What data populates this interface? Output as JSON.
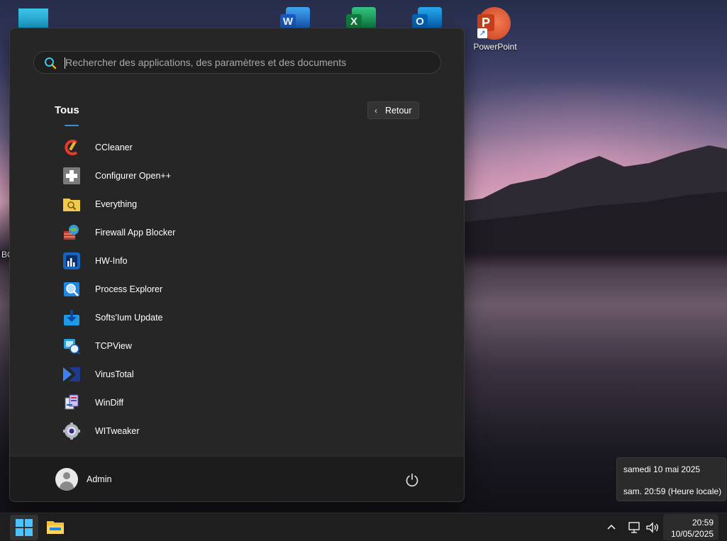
{
  "desktop": {
    "partial_label": "BC",
    "powerpoint_label": "PowerPoint"
  },
  "start_menu": {
    "search": {
      "placeholder": "Rechercher des applications, des paramètres et des documents",
      "value": ""
    },
    "section_title": "Tous",
    "back_label": "Retour",
    "apps": [
      {
        "label": "CCleaner",
        "icon": "ccleaner-icon"
      },
      {
        "label": "Configurer Open++",
        "icon": "open-plus-plus-icon"
      },
      {
        "label": "Everything",
        "icon": "everything-icon"
      },
      {
        "label": "Firewall App Blocker",
        "icon": "firewall-app-blocker-icon"
      },
      {
        "label": "HW-Info",
        "icon": "hwinfo-icon"
      },
      {
        "label": "Process Explorer",
        "icon": "process-explorer-icon"
      },
      {
        "label": "Softs'Ium Update",
        "icon": "softsium-update-icon"
      },
      {
        "label": "TCPView",
        "icon": "tcpview-icon"
      },
      {
        "label": "VirusTotal",
        "icon": "virustotal-icon"
      },
      {
        "label": "WinDiff",
        "icon": "windiff-icon"
      },
      {
        "label": "WITweaker",
        "icon": "witweaker-icon"
      }
    ],
    "user_name": "Admin"
  },
  "clock_tooltip": {
    "date_line": "samedi 10 mai 2025",
    "time_line": "sam. 20:59 (Heure locale)"
  },
  "taskbar": {
    "time": "20:59",
    "date": "10/05/2025"
  },
  "colors": {
    "accent": "#3a8fd8",
    "menu_bg": "#262626",
    "footer_bg": "#1c1c1c"
  }
}
